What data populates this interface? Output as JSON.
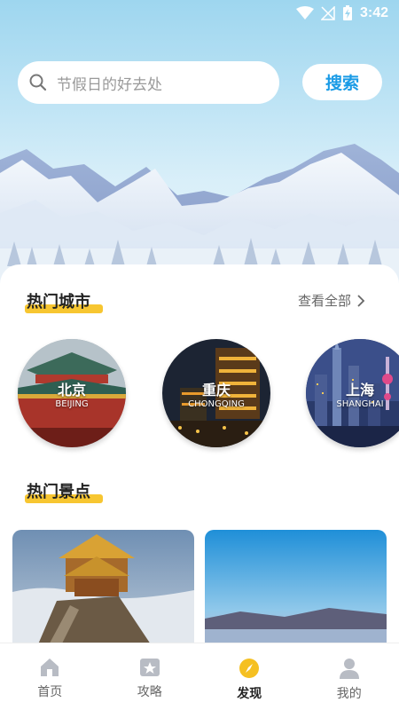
{
  "status_bar": {
    "time": "3:42"
  },
  "search": {
    "placeholder": "节假日的好去处",
    "button_label": "搜索"
  },
  "hot_cities": {
    "title": "热门城市",
    "see_all": "查看全部",
    "cities": [
      {
        "name": "北京",
        "en": "BEIJING"
      },
      {
        "name": "重庆",
        "en": "CHONGQING"
      },
      {
        "name": "上海",
        "en": "SHANGHAI"
      }
    ]
  },
  "hot_spots": {
    "title": "热门景点"
  },
  "tabs": [
    {
      "label": "首页",
      "icon": "home-icon"
    },
    {
      "label": "攻略",
      "icon": "star-card-icon"
    },
    {
      "label": "发现",
      "icon": "compass-icon",
      "active": true
    },
    {
      "label": "我的",
      "icon": "user-icon"
    }
  ],
  "colors": {
    "accent": "#1a9be6",
    "highlight": "#f7c631",
    "active_tab_icon": "#f5c022"
  }
}
